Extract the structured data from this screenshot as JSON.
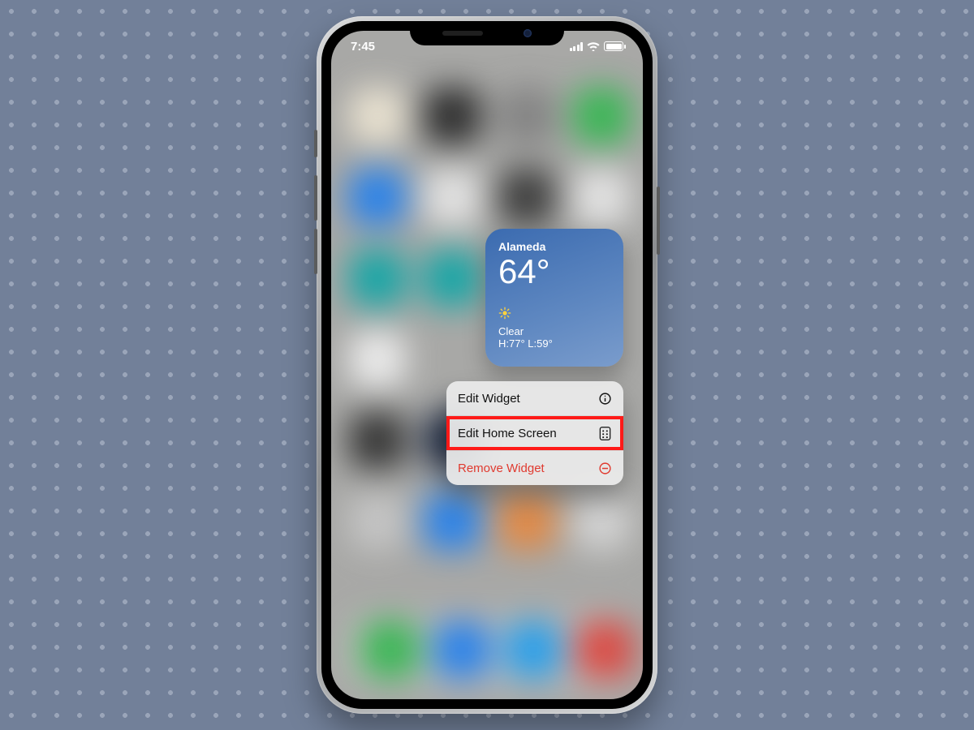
{
  "status_bar": {
    "time": "7:45"
  },
  "weather_widget": {
    "location": "Alameda",
    "temperature": "64°",
    "condition_icon": "sun-icon",
    "condition": "Clear",
    "hi_lo": "H:77° L:59°"
  },
  "context_menu": {
    "items": [
      {
        "label": "Edit Widget",
        "icon": "info-icon",
        "destructive": false,
        "highlighted": false
      },
      {
        "label": "Edit Home Screen",
        "icon": "apps-grid-icon",
        "destructive": false,
        "highlighted": true
      },
      {
        "label": "Remove Widget",
        "icon": "minus-circle-icon",
        "destructive": true,
        "highlighted": false
      }
    ]
  },
  "colors": {
    "backdrop": "#728099",
    "widget_gradient_top": "#3b6bb0",
    "widget_gradient_bottom": "#7a9ccc",
    "destructive": "#e03a2f",
    "highlight": "#ff1a18"
  }
}
